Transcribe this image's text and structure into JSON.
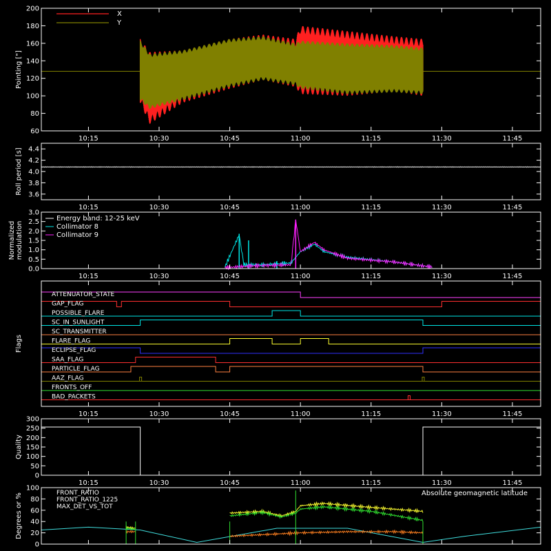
{
  "chart_data": [
    {
      "id": "pointing",
      "type": "line",
      "ylabel": "Pointing [\"]",
      "ylim": [
        60,
        200
      ],
      "yticks": [
        60,
        80,
        100,
        120,
        140,
        160,
        180,
        200
      ],
      "xlim": [
        "10:05",
        "11:51"
      ],
      "xticks": [
        "10:15",
        "10:30",
        "10:45",
        "11:00",
        "11:15",
        "11:30",
        "11:45"
      ],
      "legend": [
        {
          "name": "X",
          "color": "#ff2020"
        },
        {
          "name": "Y",
          "color": "#808000"
        }
      ],
      "legend_placement": "top-left",
      "baseline": {
        "y": 128,
        "color": "#808000"
      },
      "series": [
        {
          "name": "X",
          "color": "#ff2020",
          "x": [
            "10:26",
            "10:28",
            "10:35",
            "10:45",
            "10:52",
            "10:59",
            "11:00",
            "11:10",
            "11:20",
            "11:26"
          ],
          "upper": [
            165,
            150,
            152,
            165,
            170,
            165,
            180,
            174,
            168,
            165
          ],
          "lower": [
            92,
            68,
            92,
            108,
            118,
            110,
            102,
            100,
            105,
            100
          ]
        },
        {
          "name": "Y",
          "color": "#808000",
          "x": [
            "10:26",
            "10:28",
            "10:35",
            "10:45",
            "10:52",
            "10:59",
            "11:00",
            "11:10",
            "11:20",
            "11:26"
          ],
          "upper": [
            163,
            148,
            152,
            165,
            168,
            160,
            163,
            160,
            158,
            155
          ],
          "lower": [
            95,
            85,
            95,
            110,
            118,
            112,
            108,
            102,
            104,
            102
          ]
        }
      ]
    },
    {
      "id": "roll",
      "type": "line",
      "ylabel": "Roll period [s]",
      "ylim": [
        3.5,
        4.5
      ],
      "yticks": [
        3.6,
        3.8,
        4.0,
        4.2,
        4.4
      ],
      "yticklabels": [
        "3.6",
        "3.8",
        "4.0",
        "4.2",
        "4.4"
      ],
      "xticks": [
        "10:15",
        "10:30",
        "10:45",
        "11:00",
        "11:15",
        "11:30",
        "11:45"
      ],
      "series": [
        {
          "name": "",
          "color": "#ffffff",
          "x": [
            "10:05",
            "11:51"
          ],
          "values": [
            4.08,
            4.08
          ]
        }
      ]
    },
    {
      "id": "modulation",
      "type": "line",
      "ylabel": "Normalized modulation",
      "ylim": [
        0,
        3.0
      ],
      "yticks": [
        0.0,
        0.5,
        1.0,
        1.5,
        2.0,
        2.5,
        3.0
      ],
      "yticklabels": [
        "0.0",
        "0.5",
        "1.0",
        "1.5",
        "2.0",
        "2.5",
        "3.0"
      ],
      "xticks": [
        "10:15",
        "10:30",
        "10:45",
        "11:00",
        "11:15",
        "11:30",
        "11:45"
      ],
      "legend_title": "Energy band: 12-25 keV",
      "legend_placement": "top-left",
      "series": [
        {
          "name": "Collimator 8",
          "color": "#00e8e8",
          "x": [
            "10:44",
            "10:47",
            "10:48",
            "10:52",
            "10:58",
            "11:00",
            "11:03",
            "11:05",
            "11:10",
            "11:20",
            "11:28"
          ],
          "values": [
            0.1,
            1.8,
            0.2,
            0.2,
            0.3,
            0.9,
            1.3,
            0.9,
            0.6,
            0.35,
            0.08
          ],
          "spikes": [
            {
              "x": "10:47",
              "value": 1.85
            },
            {
              "x": "10:49",
              "value": 1.5
            },
            {
              "x": "10:55",
              "value": 0.4
            }
          ]
        },
        {
          "name": "Collimator 9",
          "color": "#ff20ff",
          "x": [
            "10:44",
            "10:50",
            "10:58",
            "10:59",
            "11:00",
            "11:03",
            "11:05",
            "11:10",
            "11:20",
            "11:28"
          ],
          "values": [
            0.05,
            0.15,
            0.2,
            2.6,
            0.9,
            1.4,
            1.0,
            0.55,
            0.35,
            0.08
          ],
          "spikes": [
            {
              "x": "10:59",
              "value": 2.6
            }
          ]
        }
      ]
    },
    {
      "id": "flags",
      "type": "step",
      "ylabel": "Flags",
      "xticks": [
        "10:15",
        "10:30",
        "10:45",
        "11:00",
        "11:15",
        "11:30",
        "11:45"
      ],
      "flags": [
        {
          "name": "ATTENUATOR_STATE",
          "color": "#ff40ff",
          "transitions": [
            [
              "10:05",
              1
            ],
            [
              "11:00",
              0
            ]
          ]
        },
        {
          "name": "GAP_FLAG",
          "color": "#ff3030",
          "transitions": [
            [
              "10:05",
              1
            ],
            [
              "10:21",
              0
            ],
            [
              "10:22",
              1
            ],
            [
              "10:45",
              0
            ],
            [
              "11:30",
              1
            ]
          ]
        },
        {
          "name": "POSSIBLE_FLARE",
          "color": "#00e8e8",
          "transitions": [
            [
              "10:05",
              0
            ],
            [
              "10:54",
              1
            ],
            [
              "11:00",
              0
            ]
          ]
        },
        {
          "name": "SC_IN_SUNLIGHT",
          "color": "#00e8e8",
          "transitions": [
            [
              "10:05",
              0
            ],
            [
              "10:26",
              1
            ],
            [
              "11:26",
              0
            ]
          ]
        },
        {
          "name": "SC_TRANSMITTER",
          "color": "#ff8040",
          "transitions": [
            [
              "10:05",
              0
            ]
          ]
        },
        {
          "name": "FLARE_FLAG",
          "color": "#ffff30",
          "transitions": [
            [
              "10:05",
              0
            ],
            [
              "10:45",
              1
            ],
            [
              "10:54",
              0
            ],
            [
              "11:00",
              1
            ],
            [
              "11:06",
              0
            ]
          ]
        },
        {
          "name": "ECLIPSE_FLAG",
          "color": "#3030ff",
          "transitions": [
            [
              "10:05",
              1
            ],
            [
              "10:26",
              0
            ],
            [
              "11:26",
              1
            ]
          ]
        },
        {
          "name": "SAA_FLAG",
          "color": "#ff3030",
          "transitions": [
            [
              "10:05",
              0
            ],
            [
              "10:25",
              1
            ],
            [
              "10:42",
              0
            ]
          ]
        },
        {
          "name": "PARTICLE_FLAG",
          "color": "#ff8040",
          "transitions": [
            [
              "10:05",
              0
            ],
            [
              "10:24",
              1
            ],
            [
              "10:42",
              0
            ],
            [
              "10:45",
              1
            ],
            [
              "11:26",
              0
            ]
          ]
        },
        {
          "name": "AAZ_FLAG",
          "color": "#808000",
          "transitions": [
            [
              "10:05",
              0
            ]
          ],
          "pulses": [
            "10:26",
            "11:26"
          ]
        },
        {
          "name": "FRONTS_OFF",
          "color": "#30e030",
          "transitions": [
            [
              "10:05",
              0
            ]
          ]
        },
        {
          "name": "BAD_PACKETS",
          "color": "#ff3030",
          "transitions": [
            [
              "10:05",
              0
            ]
          ],
          "pulses": [
            "11:23"
          ]
        }
      ]
    },
    {
      "id": "quality",
      "type": "step",
      "ylabel": "Quality",
      "ylim": [
        0,
        300
      ],
      "yticks": [
        0,
        50,
        100,
        150,
        200,
        250,
        300
      ],
      "xticks": [
        "10:15",
        "10:30",
        "10:45",
        "11:00",
        "11:15",
        "11:30",
        "11:45"
      ],
      "series": [
        {
          "name": "",
          "color": "#ffffff",
          "x": [
            "10:05",
            "10:26",
            "11:26",
            "11:51"
          ],
          "values": [
            256,
            0,
            256,
            256
          ]
        }
      ]
    },
    {
      "id": "ratios",
      "type": "line",
      "ylabel": "Degrees or %",
      "ylim": [
        0,
        100
      ],
      "yticks": [
        0,
        20,
        40,
        60,
        80,
        100
      ],
      "xticks": [
        "10:15",
        "10:30",
        "10:45",
        "11:00",
        "11:15",
        "11:30",
        "11:45"
      ],
      "legend_placement": "top-left",
      "series": [
        {
          "name": "FRONT_RATIO",
          "color": "#ffff30",
          "x": [
            "10:23",
            "10:25",
            "10:45",
            "10:52",
            "10:56",
            "10:59",
            "11:00",
            "11:05",
            "11:15",
            "11:26"
          ],
          "values": [
            30,
            28,
            55,
            58,
            50,
            58,
            68,
            72,
            65,
            58
          ]
        },
        {
          "name": "FRONT_RATIO_1225",
          "color": "#30e030",
          "x": [
            "10:23",
            "10:25",
            "10:45",
            "10:52",
            "10:56",
            "10:59",
            "11:00",
            "11:05",
            "11:15",
            "11:26"
          ],
          "values": [
            28,
            26,
            50,
            56,
            48,
            55,
            62,
            66,
            58,
            42
          ]
        },
        {
          "name": "MAX_DET_VS_TOT",
          "color": "#ff8020",
          "x": [
            "10:23",
            "10:25",
            "10:45",
            "10:55",
            "11:00",
            "11:10",
            "11:20",
            "11:26"
          ],
          "values": [
            22,
            22,
            14,
            18,
            20,
            22,
            22,
            20
          ]
        }
      ],
      "extra_series": {
        "name": "Absolute geomagnetic latitude",
        "color": "#40e0e0",
        "x": [
          "10:05",
          "10:15",
          "10:26",
          "10:38",
          "10:55",
          "11:10",
          "11:26",
          "11:35",
          "11:51"
        ],
        "values": [
          25,
          30,
          25,
          3,
          28,
          28,
          3,
          14,
          30
        ]
      }
    }
  ]
}
